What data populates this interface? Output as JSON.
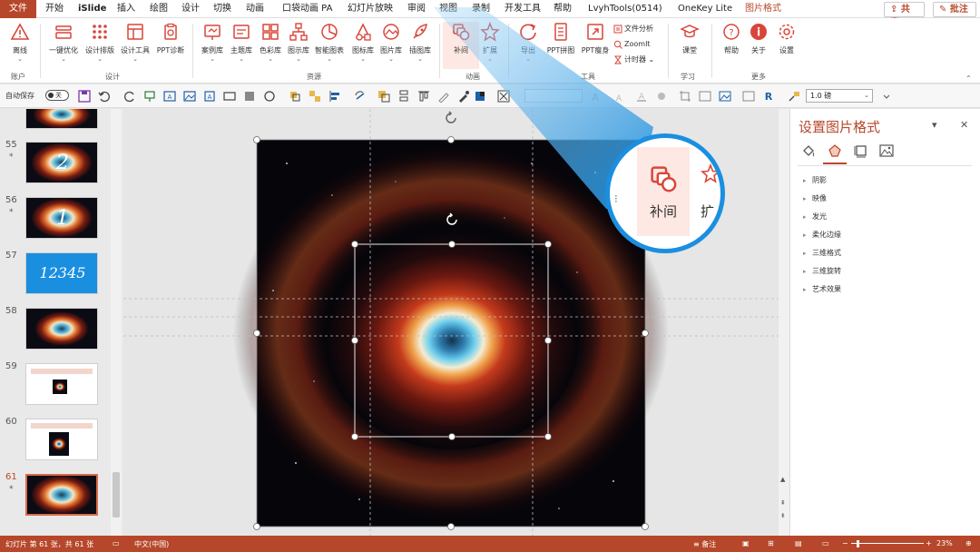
{
  "menu": {
    "tabs": [
      "文件",
      "开始",
      "iSlide",
      "插入",
      "绘图",
      "设计",
      "切换",
      "动画",
      "口袋动画 PA",
      "幻灯片放映",
      "审阅",
      "视图",
      "录制",
      "开发工具",
      "帮助",
      "LvyhTools(0514)",
      "OneKey Lite",
      "图片格式"
    ],
    "share": "共享",
    "comment": "批注"
  },
  "ribbon": {
    "buttons": [
      "离线",
      "一键优化",
      "设计排版",
      "设计工具",
      "PPT诊断",
      "案例库",
      "主题库",
      "色彩库",
      "图示库",
      "智能图表",
      "图标库",
      "图片库",
      "插图库",
      "补间",
      "扩展",
      "导出",
      "PPT拼图",
      "PPT瘦身",
      "课堂",
      "帮助",
      "关于",
      "设置"
    ],
    "small_buttons": [
      "文件分析",
      "ZoomIt",
      "计时器"
    ],
    "groups": [
      "账户",
      "设计",
      "资源",
      "动画",
      "工具",
      "学习",
      "更多"
    ],
    "icons": [
      "triangle-icon",
      "optimize-icon",
      "layout-grid-icon",
      "design-tools-icon",
      "diagnose-icon",
      "case-library-icon",
      "theme-library-icon",
      "color-library-icon",
      "diagram-library-icon",
      "smart-chart-icon",
      "icon-library-icon",
      "picture-library-icon",
      "illustration-icon",
      "tween-icon",
      "extend-icon",
      "export-icon",
      "collage-icon",
      "slim-icon",
      "classroom-icon",
      "help-icon",
      "about-icon",
      "settings-icon"
    ]
  },
  "qat": {
    "autosave_label": "自动保存",
    "autosave_state": "关",
    "line_weight": "1.0 磅"
  },
  "slides": {
    "items": [
      {
        "number": "55",
        "starred": true,
        "digit": "2"
      },
      {
        "number": "56",
        "starred": true,
        "digit": "1"
      },
      {
        "number": "57",
        "starred": false,
        "digit": "12345"
      },
      {
        "number": "58",
        "starred": false,
        "digit": ""
      },
      {
        "number": "59",
        "starred": false,
        "digit": ""
      },
      {
        "number": "60",
        "starred": false,
        "digit": ""
      },
      {
        "number": "61",
        "starred": true,
        "digit": ""
      }
    ]
  },
  "zoom_callout": {
    "button_label": "补间",
    "next_label": "扩"
  },
  "format_pane": {
    "title": "设置图片格式",
    "sections": [
      "阴影",
      "映像",
      "发光",
      "柔化边缘",
      "三维格式",
      "三维旋转",
      "艺术效果"
    ]
  },
  "status": {
    "slide_info": "幻灯片 第 61 张，共 61 张",
    "language": "中文(中国)",
    "notes": "备注",
    "zoom": "23%"
  },
  "colors": {
    "accent": "#b7472a",
    "highlight": "#fde8e3",
    "callout": "#1a8fe0"
  }
}
